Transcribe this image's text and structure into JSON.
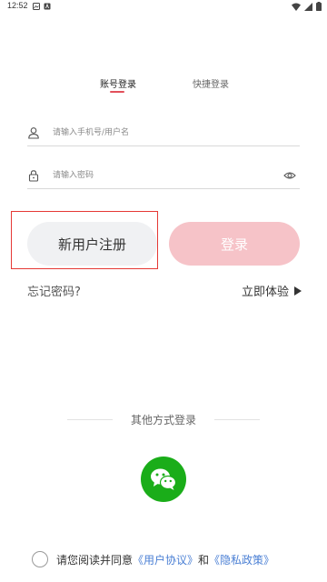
{
  "status": {
    "time": "12:52",
    "icons": [
      "gallery-notification-icon",
      "app-notification-icon",
      "wifi-icon",
      "signal-icon",
      "battery-icon"
    ]
  },
  "tabs": {
    "account": "账号登录",
    "quick": "快捷登录",
    "active": "account",
    "accent_color": "#e24f5a"
  },
  "form": {
    "username_placeholder": "请输入手机号/用户名",
    "username_value": "",
    "password_placeholder": "请输入密码",
    "password_value": ""
  },
  "buttons": {
    "register": "新用户注册",
    "login": "登录",
    "login_color": "#f6c3c8"
  },
  "links": {
    "forgot": "忘记密码?",
    "experience": "立即体验"
  },
  "other_login": {
    "label": "其他方式登录",
    "methods": [
      "wechat-icon"
    ]
  },
  "agreement": {
    "prefix": "请您阅读并同意",
    "user_agreement": "《用户协议》",
    "and": "和",
    "privacy_policy": "《隐私政策》",
    "link_color": "#4a7fd4"
  }
}
